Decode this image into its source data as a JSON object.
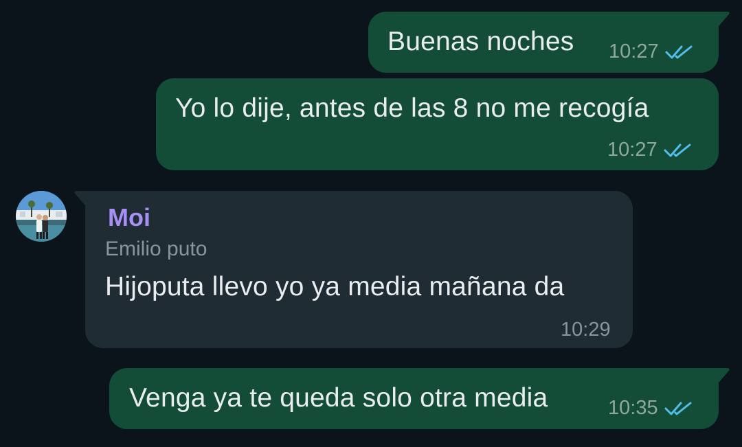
{
  "messages": [
    {
      "direction": "outgoing",
      "text": "Buenas noches",
      "time": "10:27",
      "status": "read"
    },
    {
      "direction": "outgoing",
      "text": "Yo lo dije, antes de las 8 no me recogía",
      "time": "10:27",
      "status": "read"
    },
    {
      "direction": "incoming",
      "sender": "Moi",
      "forward_label": "Emilio puto",
      "text": "Hijoputa llevo yo ya media mañana da",
      "time": "10:29"
    },
    {
      "direction": "outgoing",
      "text": "Venga ya te queda solo otra media",
      "time": "10:35",
      "status": "read"
    }
  ],
  "colors": {
    "background": "#0b141a",
    "outgoing_bubble": "#144d37",
    "incoming_bubble": "#202c33",
    "sender_name": "#a88ff5",
    "read_ticks": "#53bdeb",
    "text": "#e9edef"
  },
  "icons": {
    "read_status": "double-check-icon",
    "avatar": "contact-avatar"
  }
}
